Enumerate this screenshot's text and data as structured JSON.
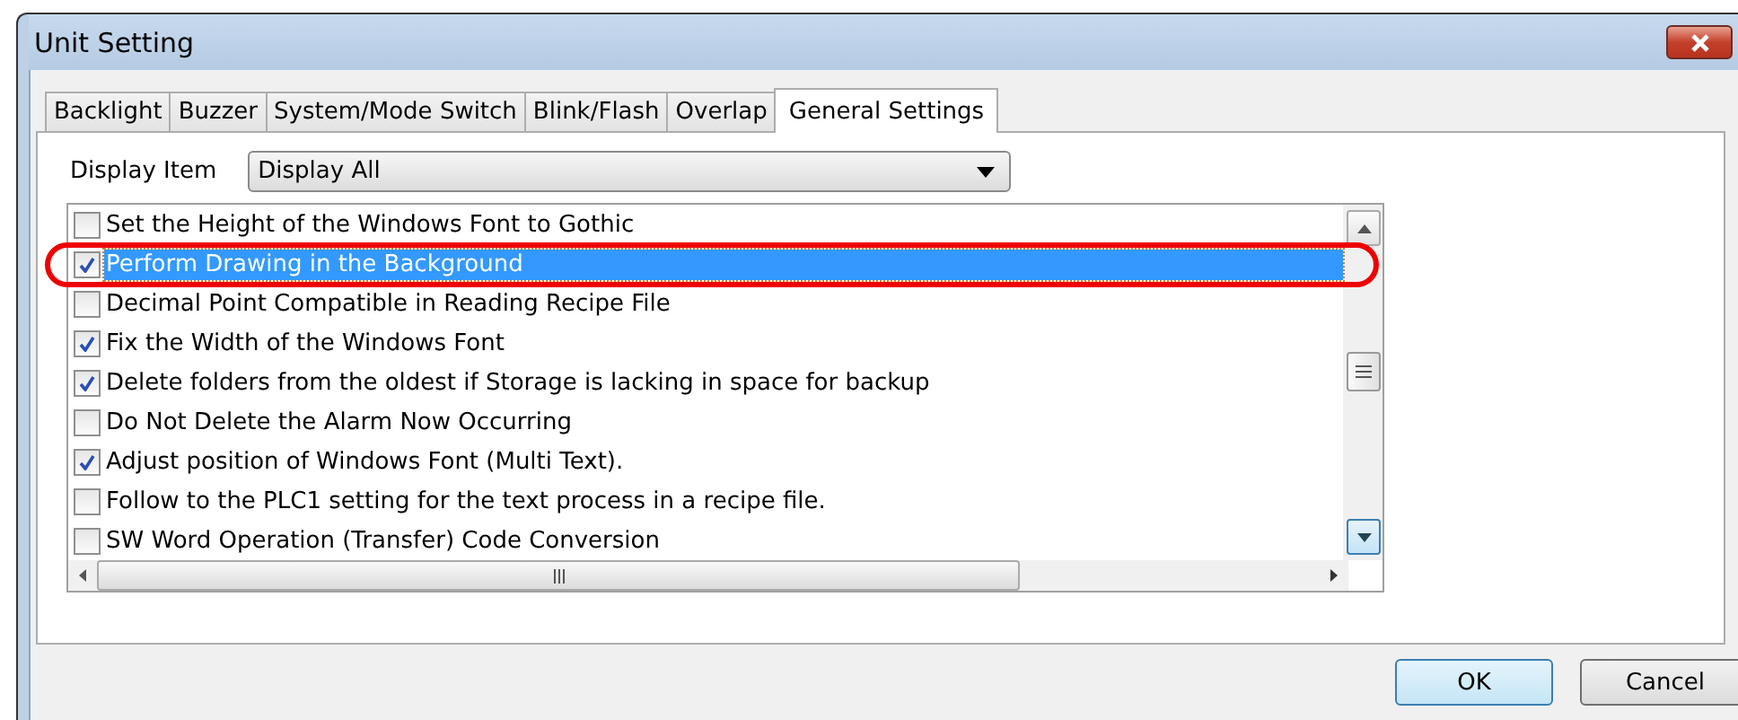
{
  "window": {
    "title": "Unit Setting"
  },
  "tabs": [
    {
      "label": "Backlight",
      "selected": false
    },
    {
      "label": "Buzzer",
      "selected": false
    },
    {
      "label": "System/Mode Switch",
      "selected": false
    },
    {
      "label": "Blink/Flash",
      "selected": false
    },
    {
      "label": "Overlap",
      "selected": false
    },
    {
      "label": "General Settings",
      "selected": true
    }
  ],
  "display_item": {
    "label": "Display Item",
    "value": "Display All"
  },
  "items": [
    {
      "label": "Set the Height of the Windows Font to Gothic",
      "checked": false,
      "selected": false,
      "highlighted": false
    },
    {
      "label": "Perform Drawing in the Background",
      "checked": true,
      "selected": true,
      "highlighted": true
    },
    {
      "label": "Decimal Point Compatible in Reading Recipe File",
      "checked": false,
      "selected": false,
      "highlighted": false
    },
    {
      "label": "Fix the Width of the Windows Font",
      "checked": true,
      "selected": false,
      "highlighted": false
    },
    {
      "label": "Delete folders from the oldest if Storage is lacking in space for backup",
      "checked": true,
      "selected": false,
      "highlighted": false
    },
    {
      "label": "Do Not Delete the Alarm Now Occurring",
      "checked": false,
      "selected": false,
      "highlighted": false
    },
    {
      "label": "Adjust position of Windows Font (Multi Text).",
      "checked": true,
      "selected": false,
      "highlighted": false
    },
    {
      "label": "Follow to the PLC1 setting for the text process in a recipe file.",
      "checked": false,
      "selected": false,
      "highlighted": false
    },
    {
      "label": "SW Word Operation (Transfer) Code Conversion",
      "checked": false,
      "selected": false,
      "highlighted": false
    }
  ],
  "buttons": [
    {
      "label": "OK",
      "kind": "default"
    },
    {
      "label": "Cancel",
      "kind": "normal"
    }
  ]
}
